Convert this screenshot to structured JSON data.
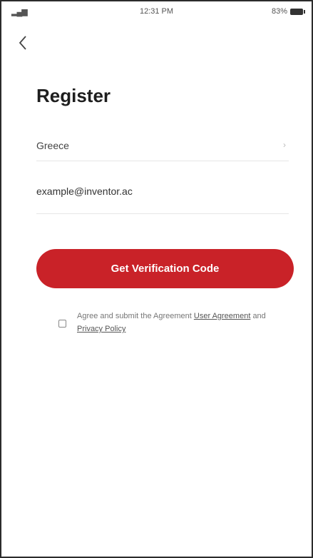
{
  "status_bar": {
    "time": "12:31 PM",
    "battery": "83%"
  },
  "header": {
    "title": "Register"
  },
  "form": {
    "country": "Greece",
    "email_value": "example@inventor.ac"
  },
  "actions": {
    "verify_label": "Get Verification Code"
  },
  "agreement": {
    "text": "Agree and submit the Agreement",
    "user_agreement": "User Agreement",
    "and": "and",
    "privacy_policy": "Privacy Policy"
  }
}
